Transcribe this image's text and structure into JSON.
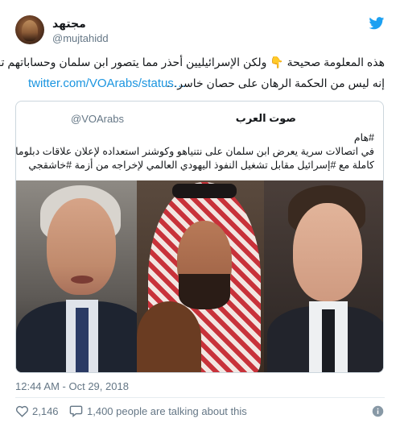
{
  "author": {
    "display_name": "مجتهد",
    "handle": "@mujtahidd"
  },
  "tweet": {
    "line1": "هذه المعلومة صحيحة 👇 ولكن الإسرائيليين أحذر مما يتصور ابن سلمان وحساباتهم تقول",
    "line2": "إنه ليس من الحكمة الرهان على حصان خاسر…",
    "link": "twitter.com/VOArabs/status…"
  },
  "quoted": {
    "name": "صوت العرب",
    "handle": "@VOArabs",
    "line1": "#هام",
    "line2": "في اتصالات سرية يعرض ابن سلمان على نتنياهو وكوشنر استعداده لإعلان علاقات دبلوماسية",
    "line3": "كاملة مع #إسرائيل مقابل تشغيل النفوذ اليهودي العالمي لإخراجه من أزمة #خاشقجي"
  },
  "footer": {
    "timestamp": "12:44 AM - Oct 29, 2018",
    "likes": "2,146",
    "talking": "1,400 people are talking about this"
  },
  "colors": {
    "link": "#1b95e0",
    "muted": "#657786",
    "border": "#ccd6dd",
    "brand": "#1da1f2"
  },
  "icons": [
    "twitter-bird-icon",
    "heart-icon",
    "reply-bubble-icon",
    "info-icon"
  ]
}
